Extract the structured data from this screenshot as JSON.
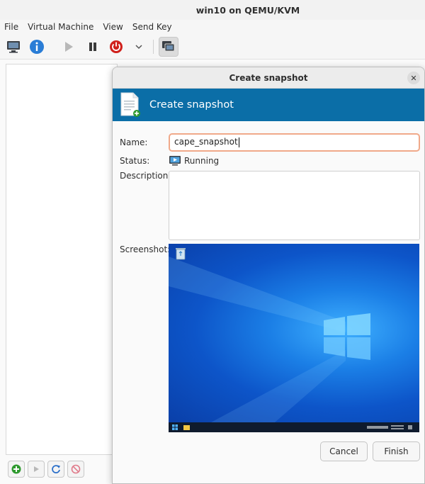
{
  "window": {
    "title": "win10 on QEMU/KVM"
  },
  "menu": [
    {
      "label": "File"
    },
    {
      "label": "Virtual Machine"
    },
    {
      "label": "View"
    },
    {
      "label": "Send Key"
    }
  ],
  "toolbar": {
    "icons": [
      "console-icon",
      "info-icon",
      "run-icon",
      "pause-icon",
      "shutdown-icon",
      "shutdown-menu-icon",
      "snapshots-icon"
    ]
  },
  "snapshot_list_actions": [
    "add-icon",
    "run-icon",
    "refresh-icon",
    "delete-icon"
  ],
  "dialog": {
    "title": "Create snapshot",
    "heading": "Create snapshot",
    "name_label": "Name:",
    "name_value": "cape_snapshot",
    "status_label": "Status:",
    "status_value": "Running",
    "description_label": "Description:",
    "description_value": "",
    "screenshot_label": "Screenshot:",
    "cancel_label": "Cancel",
    "finish_label": "Finish"
  },
  "colors": {
    "banner": "#0b6ea7",
    "input_focus": "#f0a98a",
    "shutdown": "#d0211c",
    "info": "#2a7dd6"
  }
}
